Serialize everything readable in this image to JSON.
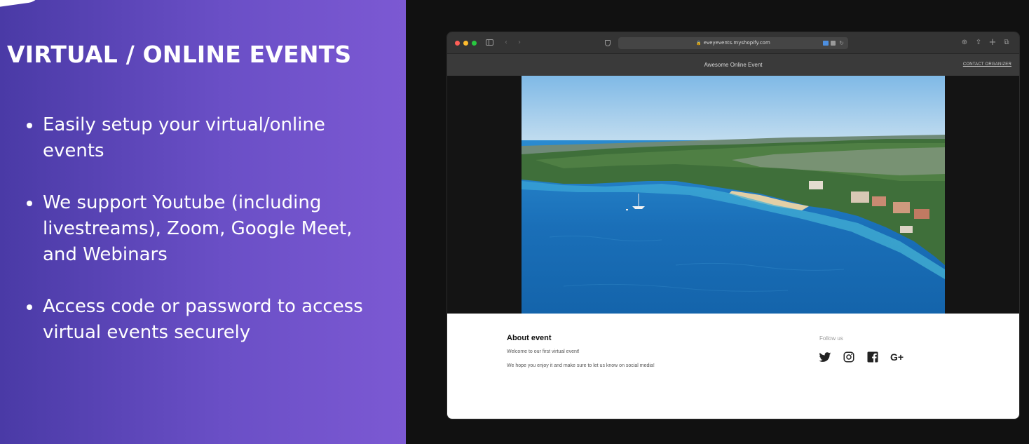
{
  "promo": {
    "heading": "VIRTUAL / ONLINE EVENTS",
    "bullets": [
      "Easily setup your virtual/online events",
      "We support Youtube (including livestreams), Zoom, Google Meet, and Webinars",
      "Access code or password to access virtual events securely"
    ],
    "colors": {
      "gradient_start": "#4a3aa6",
      "gradient_end": "#7c59d3"
    }
  },
  "browser": {
    "url": "eveyevents.myshopify.com",
    "toolbar_icons": [
      "sidebar-icon",
      "back-icon",
      "forward-icon",
      "shield-icon",
      "lock-icon",
      "reload-icon",
      "download-icon",
      "share-icon",
      "new-tab-icon",
      "tabs-overview-icon"
    ],
    "glyphs": {
      "back": "‹",
      "forward": "›",
      "lock": "🔒",
      "reload": "↻",
      "download": "⊕",
      "share": "⇪",
      "new_tab": "+",
      "tabs": "⧉"
    }
  },
  "site": {
    "title": "Awesome Online Event",
    "contact_link": "CONTACT ORGANIZER",
    "hero_image": "aerial-coastline-photo",
    "about": {
      "heading": "About event",
      "line1": "Welcome to our first virtual event!",
      "line2": "We hope you enjoy it and make sure to let us know on social media!"
    },
    "follow": {
      "heading": "Follow us",
      "networks": [
        "twitter-icon",
        "instagram-icon",
        "facebook-icon",
        "google-plus-icon"
      ],
      "googleplus_glyph": "G+"
    }
  }
}
